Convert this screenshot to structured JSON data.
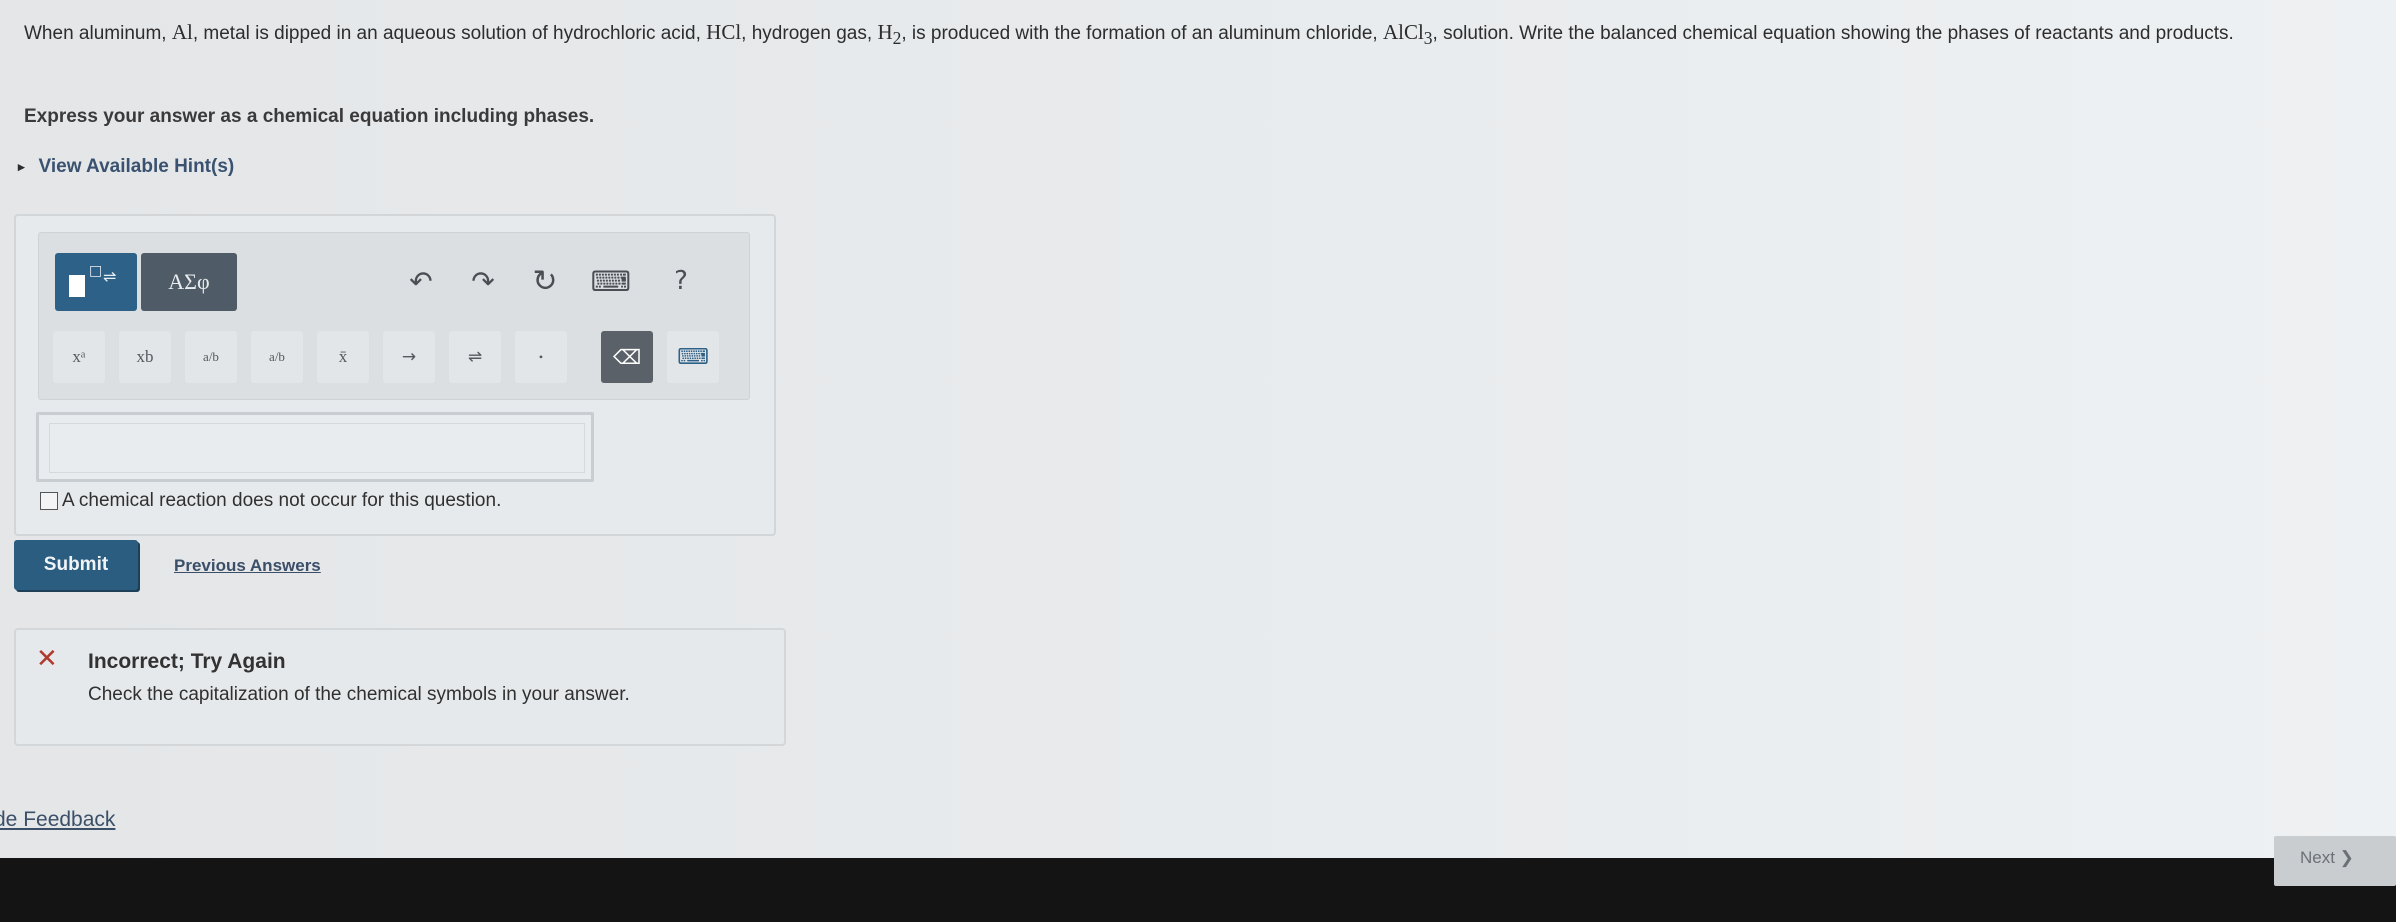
{
  "question": {
    "part1": "When aluminum, ",
    "al": "Al",
    "part2": ", metal is dipped in an aqueous solution of hydrochloric acid, ",
    "hcl": "HCl",
    "part3": ", hydrogen gas, ",
    "h2": "H",
    "h2_sub": "2",
    "part4": ", is produced with the formation of an aluminum chloride, ",
    "alcl3": "AlCl",
    "alcl3_sub": "3",
    "part5": ", solution. Write the balanced chemical equation showing the phases of reactants and products."
  },
  "instruction": "Express your answer as a chemical equation including phases.",
  "hint": {
    "arrow": "▸",
    "label": "View Available Hint(s)"
  },
  "toolbar": {
    "template_sup": "□",
    "template_arrow": "⇌",
    "greek": "ΑΣφ",
    "undo": "↶",
    "redo": "↷",
    "reset": "↻",
    "keyboard": "⌨",
    "help": "?",
    "superscript": "xᵃ",
    "subscript": "xb",
    "fraction_a": "a/b",
    "fraction_b": "a/b",
    "overline": "x̄",
    "arrow": "→",
    "equilibrium": "⇌",
    "dot": "•",
    "delete": "⌫",
    "keypad": "⌨"
  },
  "checkbox_label": "A chemical reaction does not occur for this question.",
  "submit_label": "Submit",
  "previous_answers_label": "Previous Answers",
  "feedback": {
    "icon": "✕",
    "title": "Incorrect; Try Again",
    "message": "Check the capitalization of the chemical symbols in your answer."
  },
  "feedback_link": "de Feedback",
  "next_label": "Next ❯"
}
